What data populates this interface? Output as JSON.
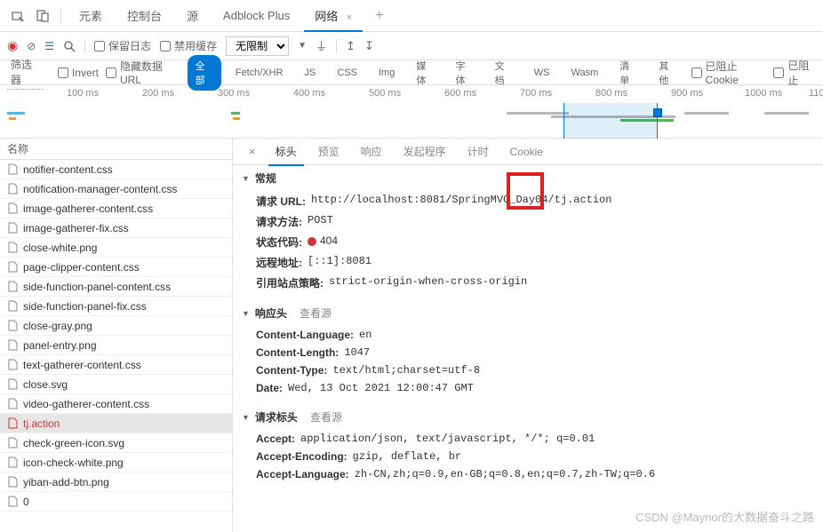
{
  "top_tabs": {
    "items": [
      {
        "label": "元素"
      },
      {
        "label": "控制台"
      },
      {
        "label": "源"
      },
      {
        "label": "Adblock Plus"
      },
      {
        "label": "网络",
        "active": true
      }
    ],
    "plus": "+"
  },
  "toolbar": {
    "preserve_log": "保留日志",
    "disable_cache": "禁用缓存",
    "throttle": "无限制"
  },
  "filter": {
    "label": "筛选器",
    "invert": "Invert",
    "hide_data": "隐藏数据 URL",
    "pills": [
      "全部",
      "Fetch/XHR",
      "JS",
      "CSS",
      "Img",
      "媒体",
      "字体",
      "文档",
      "WS",
      "Wasm",
      "清单",
      "其他"
    ],
    "blocked_cookie": "已阻止 Cookie",
    "blocked": "已阻止"
  },
  "timeline": {
    "ticks": [
      "100 ms",
      "200 ms",
      "300 ms",
      "400 ms",
      "500 ms",
      "600 ms",
      "700 ms",
      "800 ms",
      "900 ms",
      "1000 ms",
      "110"
    ]
  },
  "side": {
    "header": "名称",
    "files": [
      {
        "name": "notifier-content.css"
      },
      {
        "name": "notification-manager-content.css"
      },
      {
        "name": "image-gatherer-content.css"
      },
      {
        "name": "image-gatherer-fix.css"
      },
      {
        "name": "close-white.png"
      },
      {
        "name": "page-clipper-content.css"
      },
      {
        "name": "side-function-panel-content.css"
      },
      {
        "name": "side-function-panel-fix.css"
      },
      {
        "name": "close-gray.png"
      },
      {
        "name": "panel-entry.png"
      },
      {
        "name": "text-gatherer-content.css"
      },
      {
        "name": "close.svg"
      },
      {
        "name": "video-gatherer-content.css"
      },
      {
        "name": "tj.action",
        "selected": true,
        "red": true
      },
      {
        "name": "check-green-icon.svg"
      },
      {
        "name": "icon-check-white.png"
      },
      {
        "name": "yiban-add-btn.png"
      },
      {
        "name": "0"
      }
    ]
  },
  "detail": {
    "tabs": [
      "标头",
      "预览",
      "响应",
      "发起程序",
      "计时",
      "Cookie"
    ],
    "general": {
      "title": "常规",
      "url_k": "请求 URL:",
      "url_v": "http://localhost:8081/SpringMVC_Day04/tj.action",
      "method_k": "请求方法:",
      "method_v": "POST",
      "status_k": "状态代码:",
      "status_v": "404",
      "remote_k": "远程地址:",
      "remote_v": "[::1]:8081",
      "referrer_k": "引用站点策略:",
      "referrer_v": "strict-origin-when-cross-origin"
    },
    "response_headers": {
      "title": "响应头",
      "view_source": "查看源",
      "items": [
        {
          "k": "Content-Language:",
          "v": "en"
        },
        {
          "k": "Content-Length:",
          "v": "1047"
        },
        {
          "k": "Content-Type:",
          "v": "text/html;charset=utf-8"
        },
        {
          "k": "Date:",
          "v": "Wed, 13 Oct 2021 12:00:47 GMT"
        }
      ]
    },
    "request_headers": {
      "title": "请求标头",
      "view_source": "查看源",
      "items": [
        {
          "k": "Accept:",
          "v": "application/json, text/javascript, */*; q=0.01"
        },
        {
          "k": "Accept-Encoding:",
          "v": "gzip, deflate, br"
        },
        {
          "k": "Accept-Language:",
          "v": "zh-CN,zh;q=0.9,en-GB;q=0.8,en;q=0.7,zh-TW;q=0.6"
        }
      ]
    }
  },
  "watermark": "CSDN @Maynor的大数据奋斗之路"
}
